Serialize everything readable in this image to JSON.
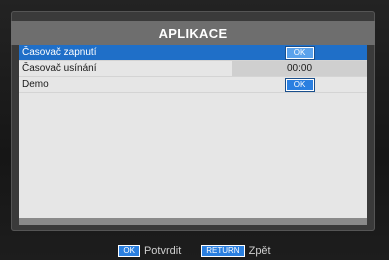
{
  "window": {
    "title": "APLIKACE"
  },
  "menu": {
    "items": [
      {
        "label": "Časovač zapnutí",
        "value": "OK",
        "value_type": "button",
        "selected": true
      },
      {
        "label": "Časovač usínání",
        "value": "00:00",
        "value_type": "text",
        "selected": false
      },
      {
        "label": "Demo",
        "value": "OK",
        "value_type": "button",
        "selected": false
      }
    ]
  },
  "footer": {
    "confirm": {
      "key": "OK",
      "label": "Potvrdit"
    },
    "back": {
      "key": "RETURN",
      "label": "Zpět"
    }
  },
  "colors": {
    "selection": "#1f6fc8",
    "button": "#2a7fe0",
    "title_bar": "#6e6e6e",
    "panel": "#e6e6e6"
  }
}
